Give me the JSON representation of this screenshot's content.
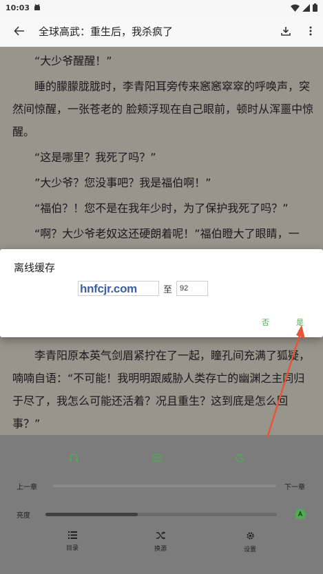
{
  "status_bar": {
    "time": "10:03"
  },
  "app_bar": {
    "title": "全球高武：重生后，我杀疯了"
  },
  "reader": {
    "paragraphs": [
      "“大少爷醒醒！”",
      "睡的朦朦胧胧时，李青阳耳旁传来窸窸窣窣的呼唤声，突然间惊醒，一张苍老的 脸颊浮现在自己眼前，顿时从浑噩中惊醒。",
      "“这是哪里？我死了吗？”",
      "”大少爷？您没事吧？我是福伯啊！”",
      "“福伯？！您不是在我年少时，为了保护我死了吗？”",
      "“啊？大少爷老奴这还硬朗着呢！”福伯瞪大了眼睛，一"
    ],
    "lower_paragraph": "李青阳原本英气剑眉紧拧在了一起，瞳孔间充满了狐疑，喃喃自语：“不可能！我明明跟威胁人类存亡的幽渊之主同归于尽了，我怎么可能还活着？况且重生？这到底是怎么回事？”"
  },
  "dialog": {
    "title": "离线缓存",
    "start_value": "",
    "to_label": "至",
    "end_value": "92",
    "watermark": "hnfcjr.com",
    "cancel_label": "否",
    "confirm_label": "是"
  },
  "bottom_menu": {
    "prev_chapter": "上一章",
    "next_chapter": "下一章",
    "brightness_label": "亮度",
    "brightness_level": 0.4,
    "nav": [
      {
        "label": "目录",
        "icon": "list-icon"
      },
      {
        "label": "换源",
        "icon": "shuffle-icon"
      },
      {
        "label": "设置",
        "icon": "gear-icon"
      }
    ],
    "top_icons": [
      "headphones-icon",
      "ad-icon",
      "moon-icon"
    ]
  },
  "colors": {
    "accent": "#4caf50",
    "annotation_arrow": "#e5553a",
    "watermark": "#3a5fa6",
    "page_background": "#f5f0e3"
  }
}
